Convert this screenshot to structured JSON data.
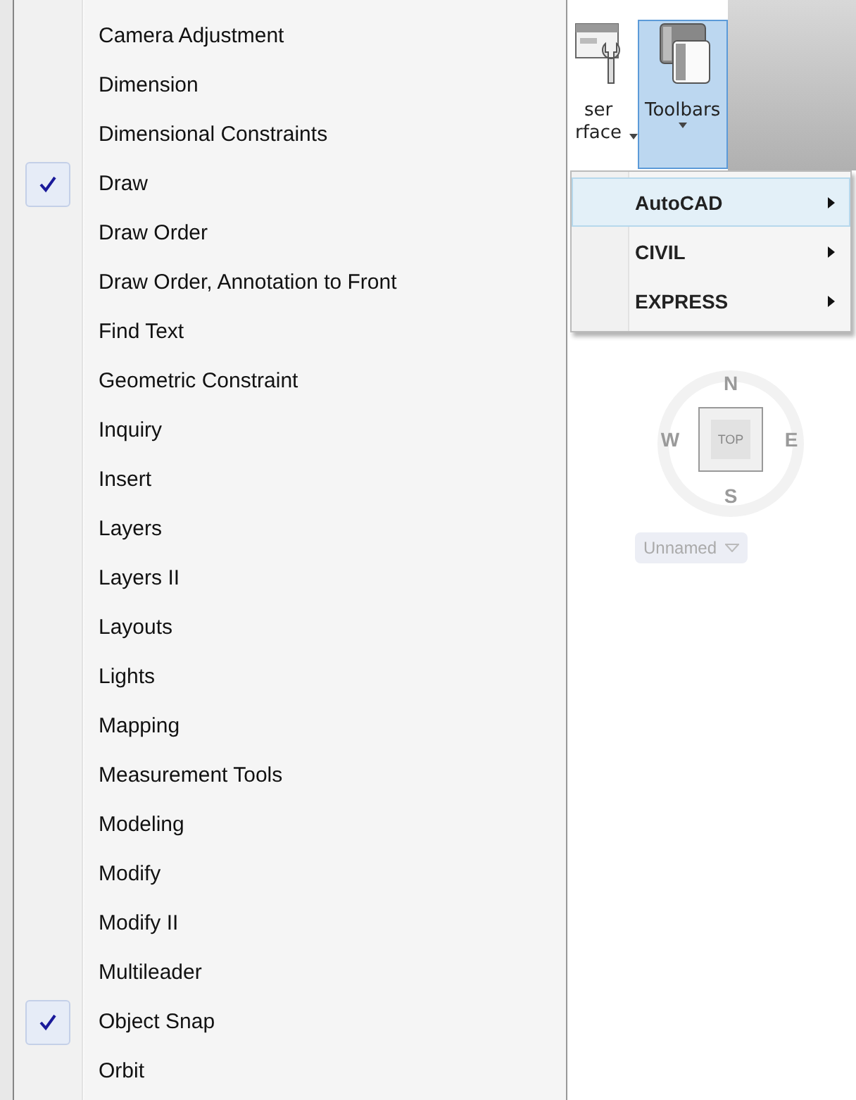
{
  "menu": {
    "items": [
      {
        "label": "Camera Adjustment",
        "checked": false
      },
      {
        "label": "Dimension",
        "checked": false
      },
      {
        "label": "Dimensional Constraints",
        "checked": false
      },
      {
        "label": "Draw",
        "checked": true
      },
      {
        "label": "Draw Order",
        "checked": false
      },
      {
        "label": "Draw Order, Annotation to Front",
        "checked": false
      },
      {
        "label": "Find Text",
        "checked": false
      },
      {
        "label": "Geometric Constraint",
        "checked": false
      },
      {
        "label": "Inquiry",
        "checked": false
      },
      {
        "label": "Insert",
        "checked": false
      },
      {
        "label": "Layers",
        "checked": false
      },
      {
        "label": "Layers II",
        "checked": false
      },
      {
        "label": "Layouts",
        "checked": false
      },
      {
        "label": "Lights",
        "checked": false
      },
      {
        "label": "Mapping",
        "checked": false
      },
      {
        "label": "Measurement Tools",
        "checked": false
      },
      {
        "label": "Modeling",
        "checked": false
      },
      {
        "label": "Modify",
        "checked": false
      },
      {
        "label": "Modify II",
        "checked": false
      },
      {
        "label": "Multileader",
        "checked": false
      },
      {
        "label": "Object Snap",
        "checked": true
      },
      {
        "label": "Orbit",
        "checked": false
      }
    ]
  },
  "ribbon": {
    "buttons": [
      {
        "kind": "user_interface",
        "lines": [
          "ser",
          "rface"
        ],
        "selected": false
      },
      {
        "kind": "toolbars",
        "lines": [
          "Toolbars"
        ],
        "selected": true
      }
    ]
  },
  "submenu": {
    "items": [
      {
        "label": "AutoCAD",
        "selected": true
      },
      {
        "label": "CIVIL",
        "selected": false
      },
      {
        "label": "EXPRESS",
        "selected": false
      }
    ]
  },
  "viewcube": {
    "face": "TOP",
    "north": "N",
    "south": "S",
    "east": "E",
    "west": "W"
  },
  "view_dropdown": {
    "value": "Unnamed"
  }
}
